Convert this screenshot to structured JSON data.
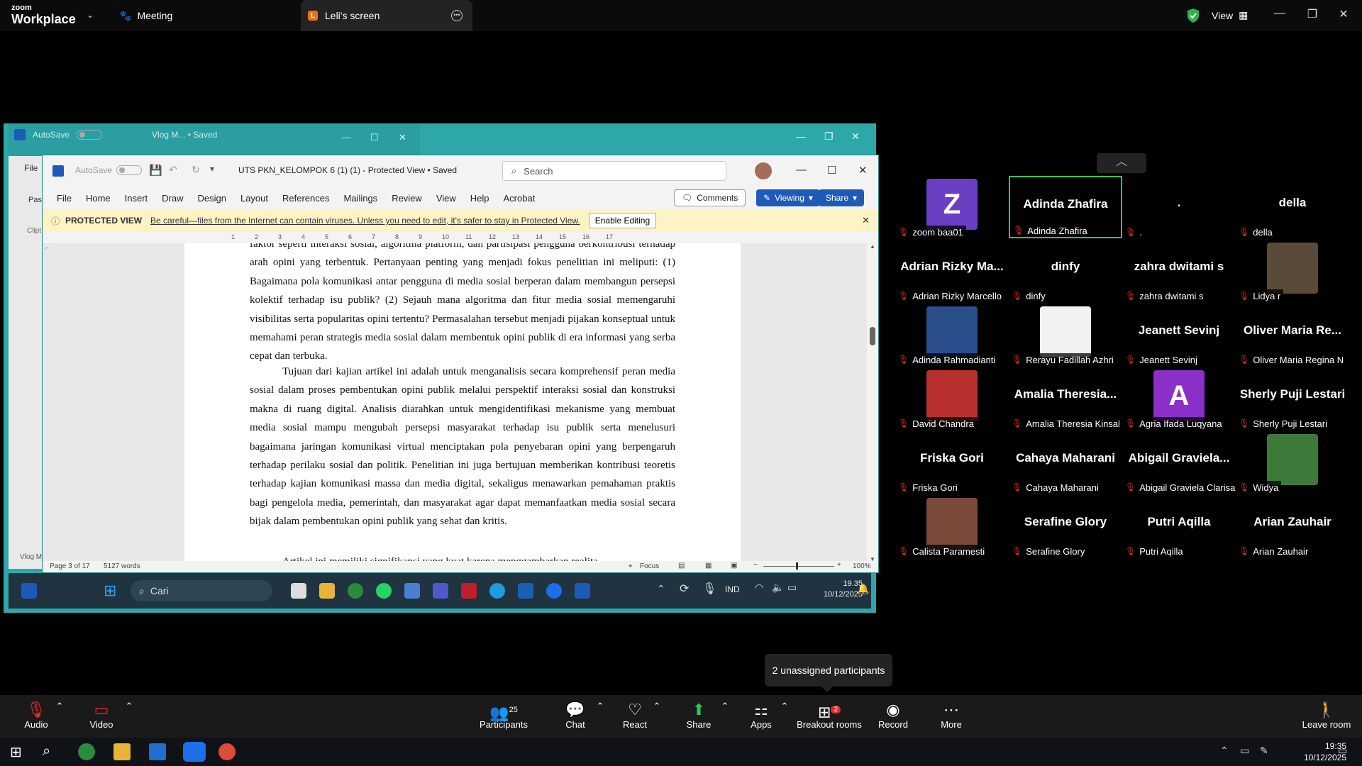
{
  "zoom": {
    "brand_top": "zoom",
    "brand_bottom": "Workplace",
    "meeting_label": "Meeting",
    "tab_title": "Leli's screen",
    "tab_badge": "L",
    "view_label": "View",
    "accent": "#0e72ed"
  },
  "back_window": {
    "autosave": "AutoSave",
    "toggle": "Off",
    "title": "Vlog M... • Saved",
    "file": "File",
    "paste": "Pas",
    "clip": "Clipt",
    "bottom_label": "Vlog M"
  },
  "word": {
    "autosave": "AutoSave",
    "toggle": "Off",
    "title": "UTS PKN_KELOMPOK 6 (1) (1) - Protected View • Saved",
    "search_placeholder": "Search",
    "menu": [
      "File",
      "Home",
      "Insert",
      "Draw",
      "Design",
      "Layout",
      "References",
      "Mailings",
      "Review",
      "View",
      "Help",
      "Acrobat"
    ],
    "comments": "Comments",
    "viewing": "Viewing",
    "share": "Share",
    "protected_label": "PROTECTED VIEW",
    "protected_msg": "Be careful—files from the Internet can contain viruses. Unless you need to edit, it's safer to stay in Protected View.",
    "enable_editing": "Enable Editing",
    "ruler_marks": [
      "1",
      "2",
      "3",
      "4",
      "5",
      "6",
      "7",
      "8",
      "9",
      "10",
      "11",
      "12",
      "13",
      "14",
      "15",
      "16",
      "17"
    ],
    "para1": "faktor seperti interaksi sosial, algoritma platform, dan partisipasi pengguna berkontribusi terhadap arah opini yang terbentuk. Pertanyaan penting yang menjadi fokus penelitian ini meliputi: (1) Bagaimana pola komunikasi antar pengguna di media sosial berperan dalam membangun persepsi kolektif terhadap isu publik? (2) Sejauh mana algoritma dan fitur media sosial memengaruhi visibilitas serta popularitas opini tertentu? Permasalahan tersebut menjadi pijakan konseptual untuk memahami peran strategis media sosial dalam membentuk opini publik di era informasi yang serba cepat dan terbuka.",
    "para2": "Tujuan dari kajian artikel ini adalah untuk menganalisis secara komprehensif peran media sosial dalam proses pembentukan opini publik melalui perspektif interaksi sosial dan konstruksi makna di ruang digital. Analisis diarahkan untuk mengidentifikasi mekanisme yang membuat media sosial mampu mengubah persepsi masyarakat terhadap isu publik serta menelusuri bagaimana jaringan komunikasi virtual menciptakan pola penyebaran opini yang berpengaruh terhadap perilaku sosial dan politik. Penelitian ini juga bertujuan memberikan kontribusi teoretis terhadap kajian komunikasi massa dan media digital, sekaligus menawarkan pemahaman praktis bagi pengelola media, pemerintah, dan masyarakat agar dapat memanfaatkan media sosial secara bijak dalam pembentukan opini publik yang sehat dan kritis.",
    "para3": "Artikel ini memiliki signifikansi yang kuat karena menggambarkan realita",
    "status_page": "Page 3 of 17",
    "status_words": "5127 words",
    "status_focus": "Focus",
    "zoom_level": "100%"
  },
  "shared_taskbar": {
    "search": "Cari",
    "lang": "IND",
    "time": "19.35",
    "date": "10/12/2025"
  },
  "participants": [
    {
      "big": "",
      "avatar": "Z",
      "avatar_color": "#6a3fc4",
      "name": "zoom baa01"
    },
    {
      "big": "Adinda Zhafira",
      "avatar": "",
      "name": "Adinda Zhafira",
      "active": true
    },
    {
      "big": ".",
      "avatar": "",
      "name": "."
    },
    {
      "big": "della",
      "avatar": "",
      "name": "della"
    },
    {
      "big": "Adrian Rizky Ma...",
      "avatar": "",
      "name": "Adrian Rizky Marcello"
    },
    {
      "big": "dinfy",
      "avatar": "",
      "name": "dinfy"
    },
    {
      "big": "zahra dwitami s",
      "avatar": "",
      "name": "zahra dwitami s"
    },
    {
      "big": "",
      "avatar": "photo",
      "avatar_color": "#5a4a3a",
      "name": "Lidya r"
    },
    {
      "big": "",
      "avatar": "photo",
      "avatar_color": "#2b4e8c",
      "name": "Adinda Rahmadianti"
    },
    {
      "big": "",
      "avatar": "photo",
      "avatar_color": "#f2f2f2",
      "name": "Rerayu Fadillah Azhri"
    },
    {
      "big": "Jeanett Sevinj",
      "avatar": "",
      "name": "Jeanett Sevinj"
    },
    {
      "big": "Oliver Maria Re...",
      "avatar": "",
      "name": "Oliver Maria Regina N"
    },
    {
      "big": "",
      "avatar": "photo",
      "avatar_color": "#b8312f",
      "name": "David Chandra"
    },
    {
      "big": "Amalia Theresia...",
      "avatar": "",
      "name": "Amalia Theresia Kinsal"
    },
    {
      "big": "",
      "avatar": "A",
      "avatar_color": "#8b2fc9",
      "name": "Agria Ifada Luqyana"
    },
    {
      "big": "Sherly Puji Lestari",
      "avatar": "",
      "name": "Sherly Puji Lestari"
    },
    {
      "big": "Friska Gori",
      "avatar": "",
      "name": "Friska Gori"
    },
    {
      "big": "Cahaya Maharani",
      "avatar": "",
      "name": "Cahaya Maharani"
    },
    {
      "big": "Abigail Graviela...",
      "avatar": "",
      "name": "Abigail Graviela Clarisa"
    },
    {
      "big": "",
      "avatar": "photo",
      "avatar_color": "#3d7a3a",
      "name": "Widya"
    },
    {
      "big": "",
      "avatar": "photo",
      "avatar_color": "#7a4a3a",
      "name": "Calista Paramesti"
    },
    {
      "big": "Serafine Glory",
      "avatar": "",
      "name": "Serafine Glory"
    },
    {
      "big": "Putri Aqilla",
      "avatar": "",
      "name": "Putri Aqilla"
    },
    {
      "big": "Arian Zauhair",
      "avatar": "",
      "name": "Arian Zauhair"
    }
  ],
  "tooltip": "2 unassigned participants",
  "controls": {
    "audio": "Audio",
    "video": "Video",
    "participants": "Participants",
    "participants_count": "25",
    "chat": "Chat",
    "react": "React",
    "share": "Share",
    "apps": "Apps",
    "breakout": "Breakout rooms",
    "breakout_badge": "2",
    "record": "Record",
    "more": "More",
    "leave": "Leave room"
  },
  "taskbar": {
    "time": "19:35",
    "date": "10/12/2025"
  }
}
